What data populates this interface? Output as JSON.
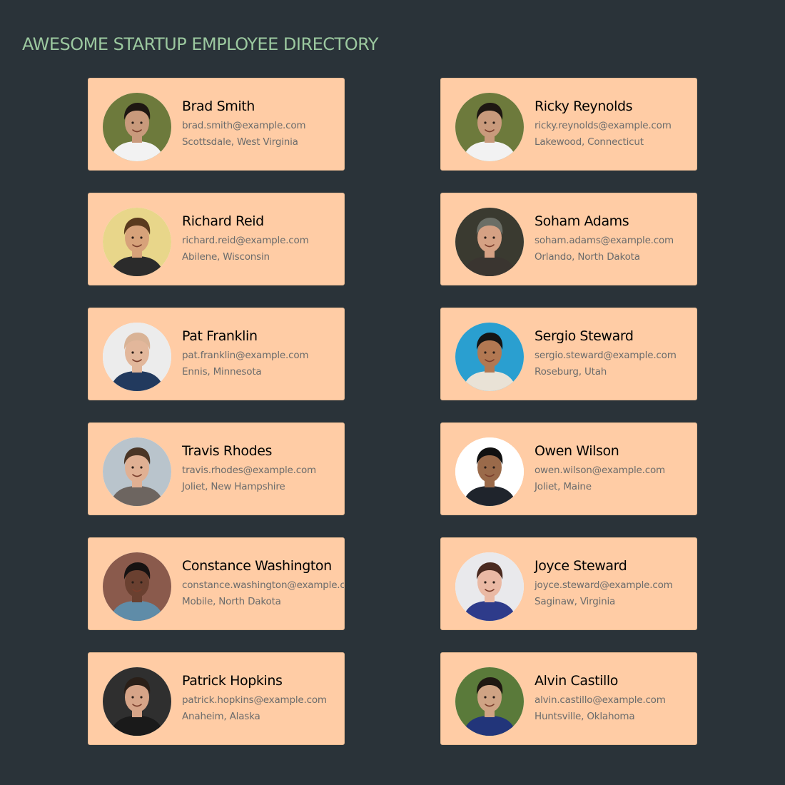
{
  "page": {
    "title": "AWESOME STARTUP EMPLOYEE DIRECTORY"
  },
  "colors": {
    "background": "#2a3339",
    "title": "#9bc89f",
    "card": "#ffcca5",
    "name": "#000000",
    "meta": "#6c6c6c"
  },
  "employees": [
    {
      "name": "Brad Smith",
      "email": "brad.smith@example.com",
      "location": "Scottsdale, West Virginia",
      "photo": {
        "bg": "#6d7a3c",
        "skin": "#c99a7c",
        "hair": "#1e1712",
        "shirt": "#f2f2f2"
      }
    },
    {
      "name": "Ricky Reynolds",
      "email": "ricky.reynolds@example.com",
      "location": "Lakewood, Connecticut",
      "photo": {
        "bg": "#6d7a3c",
        "skin": "#c99a7c",
        "hair": "#1e1712",
        "shirt": "#f2f2f2"
      }
    },
    {
      "name": "Richard Reid",
      "email": "richard.reid@example.com",
      "location": "Abilene, Wisconsin",
      "photo": {
        "bg": "#e8d68a",
        "skin": "#d7a27a",
        "hair": "#5a3a1e",
        "shirt": "#2b2b2b"
      }
    },
    {
      "name": "Soham Adams",
      "email": "soham.adams@example.com",
      "location": "Orlando, North Dakota",
      "photo": {
        "bg": "#3a3a30",
        "skin": "#d5a184",
        "hair": "#6b6e66",
        "shirt": "#3a3530"
      }
    },
    {
      "name": "Pat Franklin",
      "email": "pat.franklin@example.com",
      "location": "Ennis, Minnesota",
      "photo": {
        "bg": "#ececec",
        "skin": "#e2b79b",
        "hair": "#d9b396",
        "shirt": "#223a5e"
      }
    },
    {
      "name": "Sergio Steward",
      "email": "sergio.steward@example.com",
      "location": "Roseburg, Utah",
      "photo": {
        "bg": "#2a9fd0",
        "skin": "#b27852",
        "hair": "#151515",
        "shirt": "#e9e2d6"
      }
    },
    {
      "name": "Travis Rhodes",
      "email": "travis.rhodes@example.com",
      "location": "Joliet, New Hampshire",
      "photo": {
        "bg": "#b9c4cc",
        "skin": "#e0b093",
        "hair": "#4a3525",
        "shirt": "#6d6560"
      }
    },
    {
      "name": "Owen Wilson",
      "email": "owen.wilson@example.com",
      "location": "Joliet, Maine",
      "photo": {
        "bg": "#ffffff",
        "skin": "#9a6a4a",
        "hair": "#111111",
        "shirt": "#1f242c"
      }
    },
    {
      "name": "Constance Washington",
      "email": "constance.washington@example.com",
      "location": "Mobile, North Dakota",
      "photo": {
        "bg": "#8a5a4c",
        "skin": "#6a4030",
        "hair": "#161212",
        "shirt": "#5f8ca8"
      }
    },
    {
      "name": "Joyce Steward",
      "email": "joyce.steward@example.com",
      "location": "Saginaw, Virginia",
      "photo": {
        "bg": "#e9e9ec",
        "skin": "#eab9a4",
        "hair": "#4a2a20",
        "shirt": "#2e3b8a"
      }
    },
    {
      "name": "Patrick Hopkins",
      "email": "patrick.hopkins@example.com",
      "location": "Anaheim, Alaska",
      "photo": {
        "bg": "#2f2f2f",
        "skin": "#d6a488",
        "hair": "#2a1f18",
        "shirt": "#1a1a1a"
      }
    },
    {
      "name": "Alvin Castillo",
      "email": "alvin.castillo@example.com",
      "location": "Huntsville, Oklahoma",
      "photo": {
        "bg": "#5a7a3a",
        "skin": "#cfa384",
        "hair": "#1f1812",
        "shirt": "#22357a"
      }
    }
  ]
}
